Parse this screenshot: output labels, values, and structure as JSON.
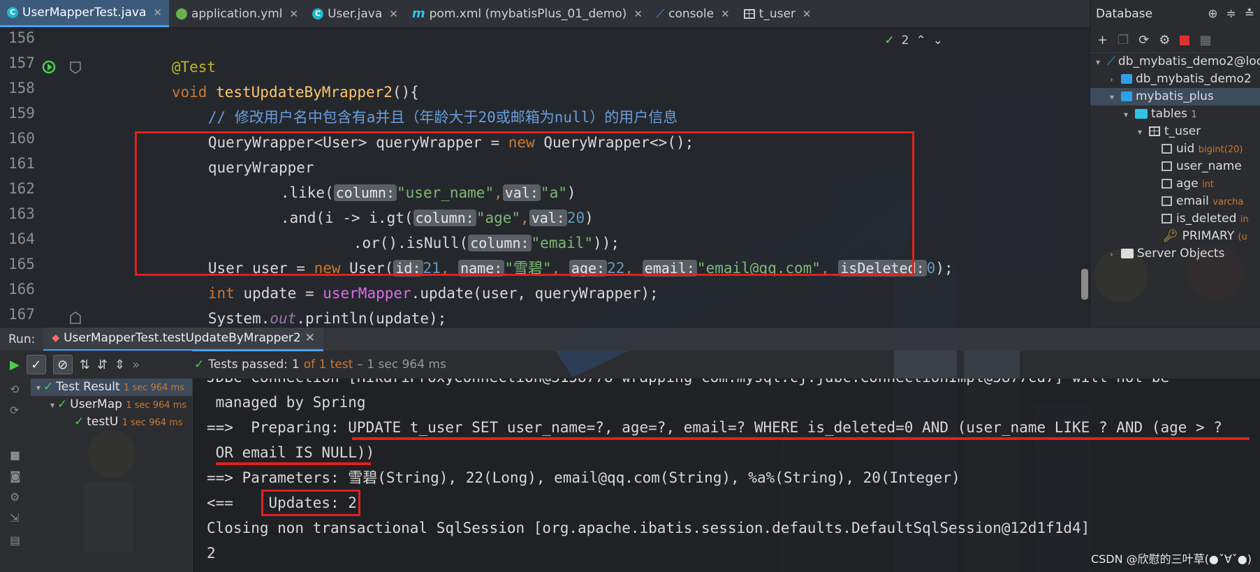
{
  "tabs": [
    {
      "label": "UserMapperTest.java",
      "icon": "class-icon",
      "active": true
    },
    {
      "label": "application.yml",
      "icon": "yaml-icon",
      "active": false
    },
    {
      "label": "User.java",
      "icon": "class-icon",
      "active": false
    },
    {
      "label": "pom.xml (mybatisPlus_01_demo)",
      "icon": "maven-icon",
      "active": false
    },
    {
      "label": "console",
      "icon": "console-icon",
      "active": false
    },
    {
      "label": "t_user",
      "icon": "table-icon",
      "active": false
    }
  ],
  "inspection": {
    "count": "2"
  },
  "editor": {
    "line_numbers": [
      "156",
      "157",
      "158",
      "159",
      "160",
      "161",
      "162",
      "163",
      "164",
      "165",
      "166",
      "167"
    ],
    "l156": {
      "annotation": "@Test"
    },
    "l157": {
      "void": "void",
      "method": "testUpdateByMrapper2",
      "rest": "(){"
    },
    "l158": {
      "prefix": "// ",
      "comment": "修改用户名中包含有a并且（年龄大于20或邮箱为null）的用户信息"
    },
    "l159": {
      "type": "QueryWrapper<User> queryWrapper = ",
      "new": "new",
      "rest": " QueryWrapper<>();"
    },
    "l160": {
      "text": "queryWrapper"
    },
    "l161": {
      "pre": ".like(",
      "hint_col": "column:",
      "s1": "\"user_name\"",
      "comma": ",",
      "hint_val": "val:",
      "s2": "\"a\"",
      "close": ")"
    },
    "l162": {
      "pre": ".and(i -> i.gt(",
      "hint_col": "column:",
      "s1": "\"age\"",
      "comma": ",",
      "hint_val": "val:",
      "n1": "20",
      "close": ")"
    },
    "l163": {
      "pre": ".or().isNull(",
      "hint_col": "column:",
      "s1": "\"email\"",
      "close": "));"
    },
    "l164": {
      "pre": "User user = ",
      "new": "new",
      "ctor": " User(",
      "h_id": "id:",
      "v_id": "21",
      "c1": ", ",
      "h_name": "name:",
      "v_name": "\"雪碧\"",
      "c2": ", ",
      "h_age": "age:",
      "v_age": "22",
      "c3": ", ",
      "h_email": "email:",
      "v_email": "\"email@qq.com\"",
      "c4": ", ",
      "h_del": "isDeleted:",
      "v_del": "0",
      "close": ");"
    },
    "l165": {
      "int": "int",
      "mid": " update = ",
      "mapper": "userMapper",
      "rest": ".update(user, queryWrapper);"
    },
    "l166": {
      "pre": "System.",
      "out": "out",
      "rest": ".println(update);"
    },
    "l167": {
      "text": "}"
    }
  },
  "database": {
    "title": "Database",
    "tree": [
      {
        "label": "db_mybatis_demo2@loca",
        "kind": "connection"
      },
      {
        "label": "db_mybatis_demo2",
        "kind": "schema"
      },
      {
        "label": "mybatis_plus",
        "kind": "schema"
      },
      {
        "label": "tables",
        "kind": "folder",
        "count": "1"
      },
      {
        "label": "t_user",
        "kind": "table"
      },
      {
        "label": "uid",
        "kind": "column",
        "type": "bigint(20)"
      },
      {
        "label": "user_name",
        "kind": "column",
        "type": ""
      },
      {
        "label": "age",
        "kind": "column",
        "type": "int"
      },
      {
        "label": "email",
        "kind": "column",
        "type": "varcha"
      },
      {
        "label": "is_deleted",
        "kind": "column",
        "type": "in"
      },
      {
        "label": "PRIMARY",
        "kind": "key",
        "type": "(u"
      },
      {
        "label": "Server Objects",
        "kind": "folder"
      }
    ]
  },
  "run": {
    "label": "Run:",
    "tab": "UserMapperTest.testUpdateByMrapper2",
    "status_prefix": "Tests passed: ",
    "status_count": "1",
    "status_of": " of 1 test",
    "status_time": " – 1 sec 964 ms",
    "tree": [
      {
        "label": "Test Result",
        "time": "1 sec 964 ms"
      },
      {
        "label": "UserMap",
        "time": "1 sec 964 ms"
      },
      {
        "label": "testU",
        "time": "1 sec 964 ms"
      }
    ]
  },
  "console": {
    "lines": [
      "JDBC Connection [HikariProxyConnection@3158778 wrapping com.mysql.cj.jdbc.ConnectionImpl@5877cd7] will not be",
      " managed by Spring",
      "==>  Preparing: UPDATE t_user SET user_name=?, age=?, email=? WHERE is_deleted=0 AND (user_name LIKE ? AND (age > ?",
      " OR email IS NULL))",
      "==> Parameters: 雪碧(String), 22(Long), email@qq.com(String), %a%(String), 20(Integer)",
      "<==    Updates: 2",
      "Closing non transactional SqlSession [org.apache.ibatis.session.defaults.DefaultSqlSession@12d1f1d4]",
      "2"
    ]
  },
  "watermark": "CSDN @欣慰的三叶草(●ˇ∀ˇ●)",
  "colors": {
    "highlight_box": "#e02020",
    "accent_tab": "#4a9eff",
    "pass_green": "#4ad04a"
  }
}
